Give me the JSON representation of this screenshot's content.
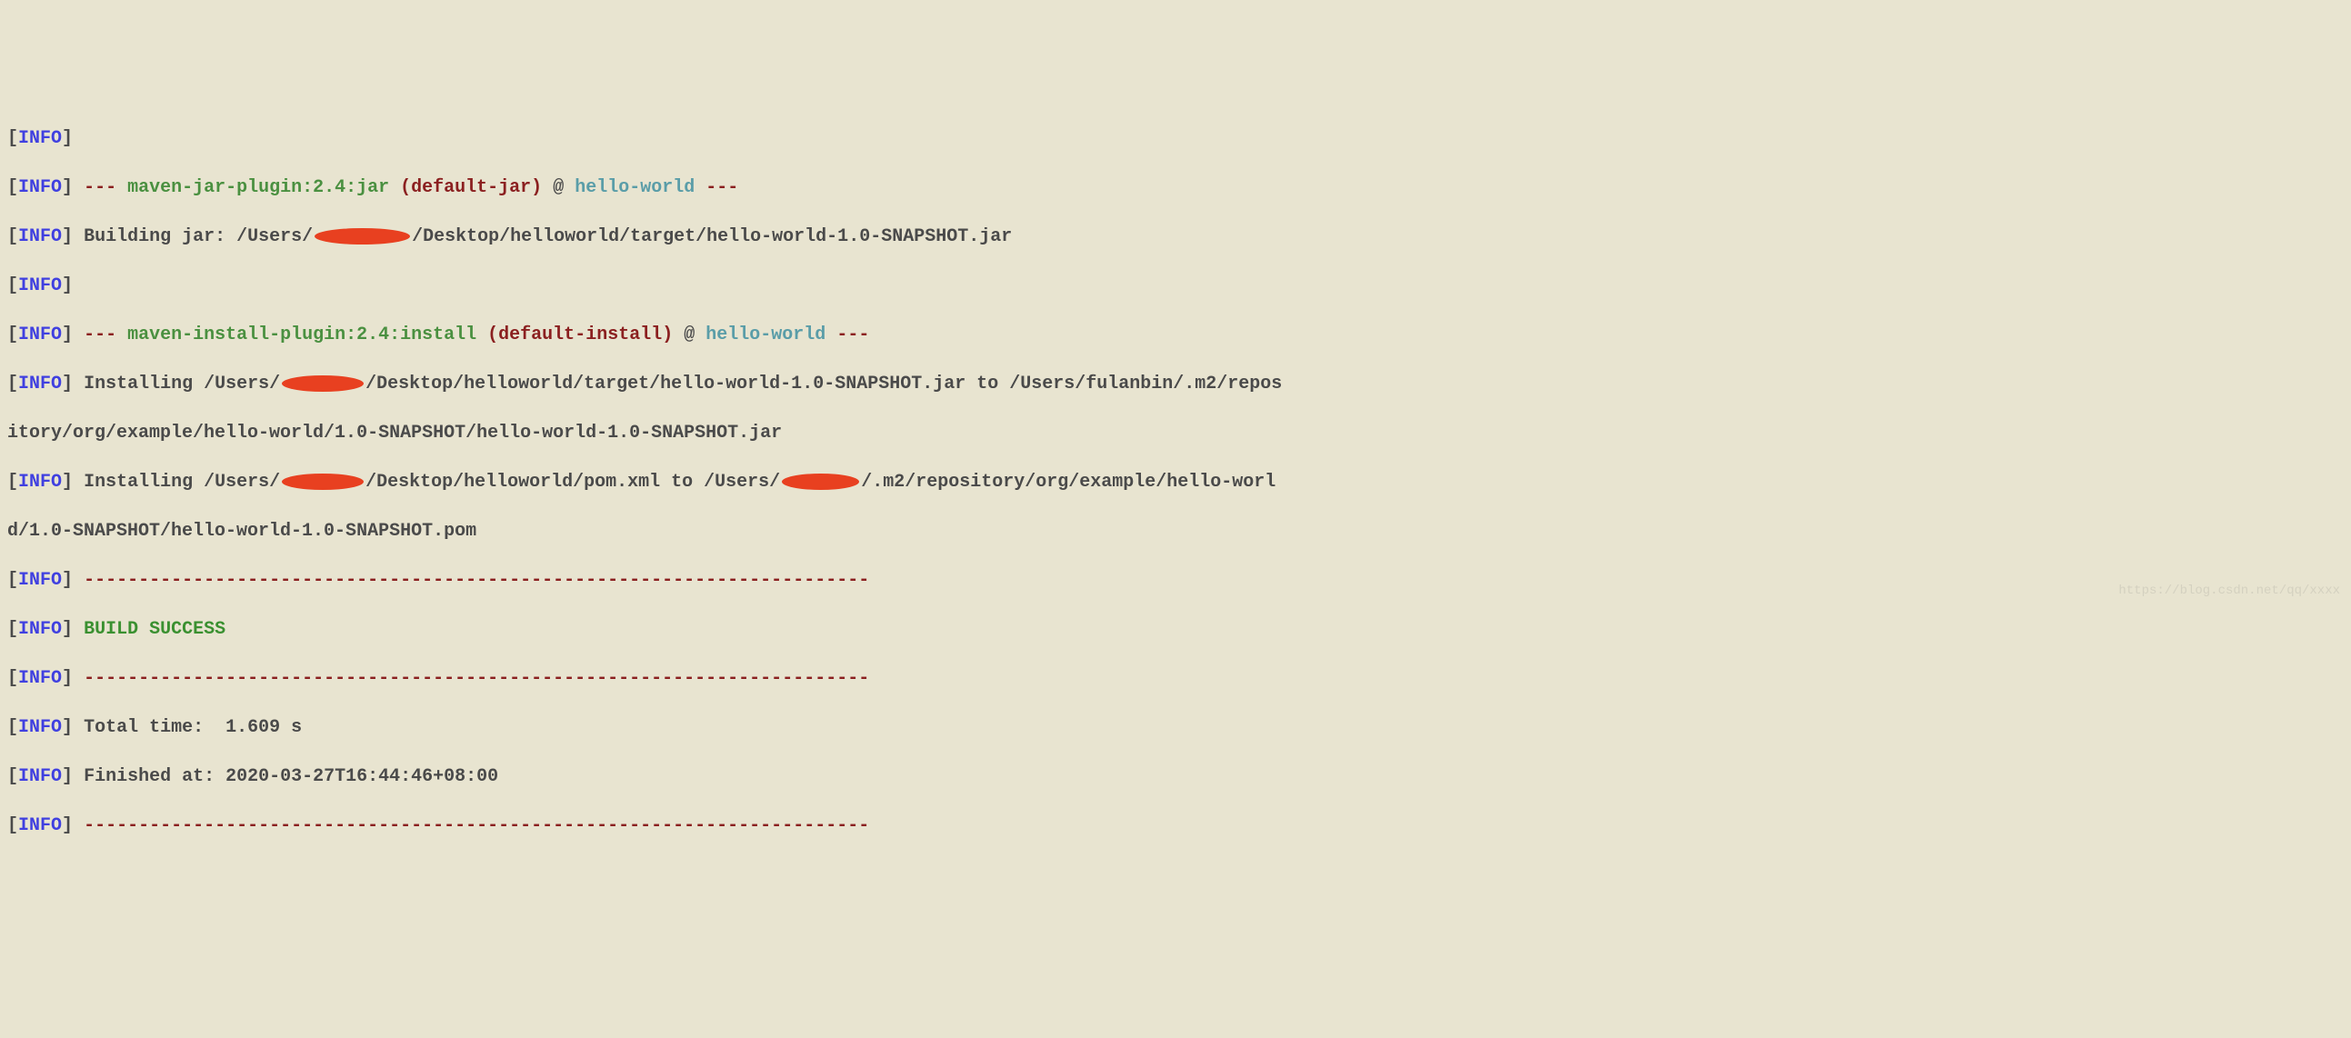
{
  "log": {
    "info_label": "INFO",
    "bracket_open": "[",
    "bracket_close": "]",
    "dashes_triple": "---",
    "at_symbol": "@",
    "colon_space": " ",
    "plugin_jar": "maven-jar-plugin:2.4:jar",
    "default_jar": "(default-jar)",
    "plugin_install": "maven-install-plugin:2.4:install",
    "default_install": "(default-install)",
    "project_name": "hello-world",
    "building_jar_prefix": "Building jar: /Users/",
    "building_jar_suffix": "/Desktop/helloworld/target/hello-world-1.0-SNAPSHOT.jar",
    "installing1_prefix": "Installing /Users/",
    "installing1_mid": "/Desktop/helloworld/target/hello-world-1.0-SNAPSHOT.jar to /Users/fulanbin/.m2/repos",
    "installing1_wrap": "itory/org/example/hello-world/1.0-SNAPSHOT/hello-world-1.0-SNAPSHOT.jar",
    "installing2_prefix": "Installing /Users/",
    "installing2_mid": "/Desktop/helloworld/pom.xml to /Users/",
    "installing2_suffix": "/.m2/repository/org/example/hello-worl",
    "installing2_wrap": "d/1.0-SNAPSHOT/hello-world-1.0-SNAPSHOT.pom",
    "dashes_long": "------------------------------------------------------------------------",
    "build_success": "BUILD SUCCESS",
    "total_time": "Total time:  1.609 s",
    "finished_at": "Finished at: 2020-03-27T16:44:46+08:00"
  },
  "watermark": "https://blog.csdn.net/qq/xxxx"
}
